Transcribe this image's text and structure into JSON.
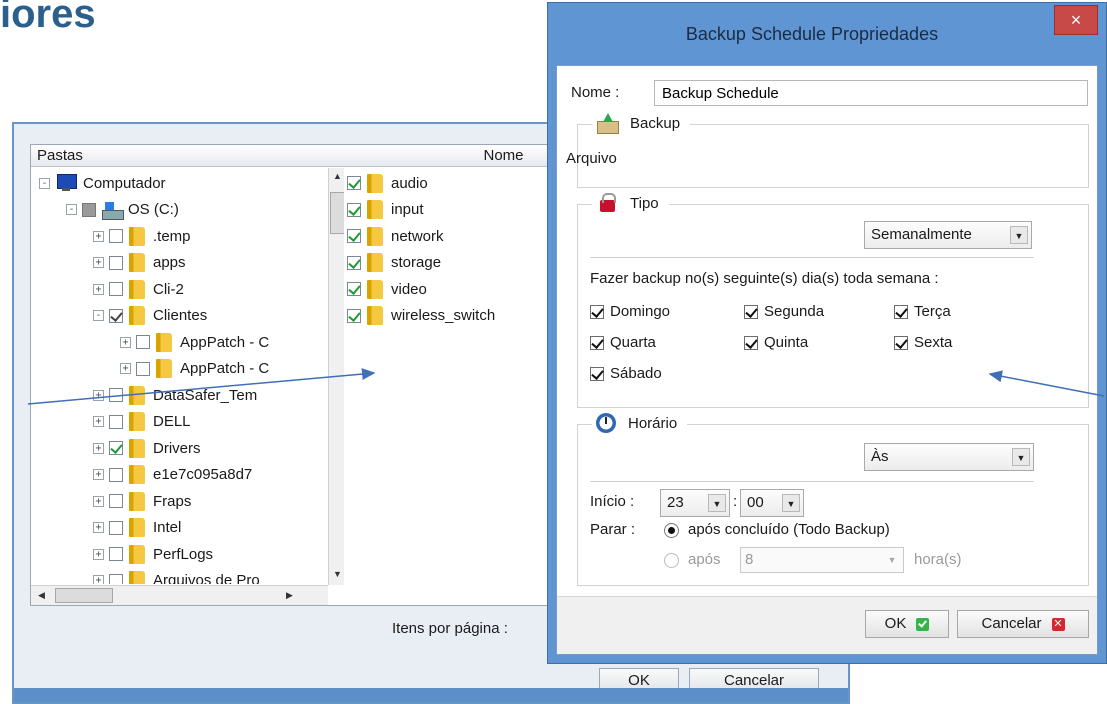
{
  "heading": "iores",
  "folder_window": {
    "folders_header": "Pastas",
    "name_header": "Nome",
    "tree": [
      {
        "label": "Computador",
        "level": 0,
        "icon": "computer",
        "check": "none",
        "expander": "-"
      },
      {
        "label": "OS (C:)",
        "level": 1,
        "icon": "drive",
        "check": "grey",
        "expander": "-"
      },
      {
        "label": ".temp",
        "level": 2,
        "icon": "folder",
        "check": "unchecked",
        "expander": "+"
      },
      {
        "label": "apps",
        "level": 2,
        "icon": "folder",
        "check": "unchecked",
        "expander": "+"
      },
      {
        "label": "Cli-2",
        "level": 2,
        "icon": "folder",
        "check": "unchecked",
        "expander": "+"
      },
      {
        "label": "Clientes",
        "level": 2,
        "icon": "folder",
        "check": "partial",
        "expander": "-"
      },
      {
        "label": "AppPatch - C",
        "level": 3,
        "icon": "folder",
        "check": "unchecked",
        "expander": "+"
      },
      {
        "label": "AppPatch - C",
        "level": 3,
        "icon": "folder",
        "check": "unchecked",
        "expander": "+"
      },
      {
        "label": "DataSafer_Tem",
        "level": 2,
        "icon": "folder",
        "check": "unchecked",
        "expander": "+"
      },
      {
        "label": "DELL",
        "level": 2,
        "icon": "folder",
        "check": "unchecked",
        "expander": "+"
      },
      {
        "label": "Drivers",
        "level": 2,
        "icon": "folder",
        "check": "checked",
        "expander": "+"
      },
      {
        "label": "e1e7c095a8d7",
        "level": 2,
        "icon": "folder",
        "check": "unchecked",
        "expander": "+"
      },
      {
        "label": "Fraps",
        "level": 2,
        "icon": "folder",
        "check": "unchecked",
        "expander": "+"
      },
      {
        "label": "Intel",
        "level": 2,
        "icon": "folder",
        "check": "unchecked",
        "expander": "+"
      },
      {
        "label": "PerfLogs",
        "level": 2,
        "icon": "folder",
        "check": "unchecked",
        "expander": "+"
      },
      {
        "label": "Arquivos de Pro",
        "level": 2,
        "icon": "folder",
        "check": "unchecked",
        "expander": "+"
      }
    ],
    "files": [
      {
        "label": "audio",
        "checked": true
      },
      {
        "label": "input",
        "checked": true
      },
      {
        "label": "network",
        "checked": true
      },
      {
        "label": "storage",
        "checked": true
      },
      {
        "label": "video",
        "checked": true
      },
      {
        "label": "wireless_switch",
        "checked": true
      }
    ],
    "items_per_page_label": "Itens por página :",
    "ok_label": "OK",
    "cancel_label": "Cancelar"
  },
  "dialog": {
    "title": "Backup Schedule Propriedades",
    "close_label": "×",
    "name_label": "Nome :",
    "name_value": "Backup Schedule",
    "backup_group": {
      "title": "Backup",
      "value": "Arquivo"
    },
    "tipo_group": {
      "title": "Tipo",
      "frequency": "Semanalmente",
      "days_prompt": "Fazer backup no(s) seguinte(s) dia(s) toda semana :",
      "days": [
        "Domingo",
        "Segunda",
        "Terça",
        "Quarta",
        "Quinta",
        "Sexta",
        "Sábado"
      ]
    },
    "horario_group": {
      "title": "Horário",
      "mode": "Às",
      "start_label": "Início :",
      "start_hour": "23",
      "time_separator": ":",
      "start_minute": "00",
      "stop_label": "Parar :",
      "stop_option_1": "após concluído  (Todo Backup)",
      "stop_option_2": "após",
      "hours_value": "8",
      "hours_unit": "hora(s)"
    },
    "ok_label": "OK",
    "cancel_label": "Cancelar"
  },
  "colors": {
    "dialog_frame": "#5f95d2",
    "heading": "#2b5f8e",
    "close_button": "#c74a48",
    "check_green": "#1f9b34",
    "annotation_arrow": "#3f6fb5"
  }
}
